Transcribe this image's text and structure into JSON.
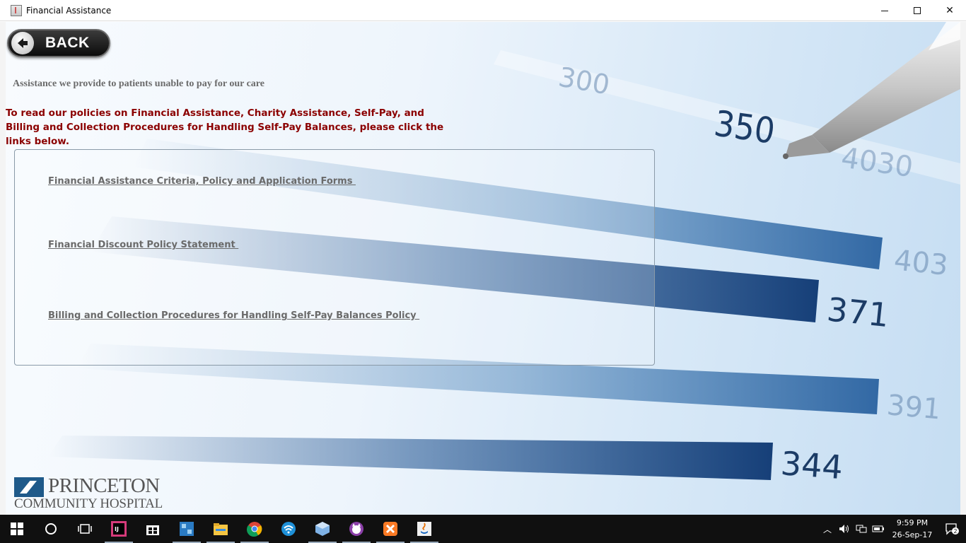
{
  "window": {
    "title": "Financial Assistance"
  },
  "back_button": {
    "label": "BACK"
  },
  "subtitle": "Assistance we provide to patients unable to pay for our care",
  "intro": "To read our policies on Financial Assistance, Charity Assistance, Self-Pay, and Billing and Collection Procedures for Handling Self-Pay Balances, please click the links below.",
  "links": [
    {
      "label": "Financial Assistance Criteria, Policy and Application Forms "
    },
    {
      "label": "Financial Discount Policy Statement "
    },
    {
      "label": "Billing and Collection Procedures for Handling Self-Pay Balances Policy "
    }
  ],
  "logo": {
    "line1": "PRINCETON",
    "line2": "COMMUNITY HOSPITAL"
  },
  "background_numbers": [
    "350",
    "371",
    "344",
    "4030",
    "403",
    "391",
    "300"
  ],
  "taskbar": {
    "apps": [
      "start-icon",
      "cortana-icon",
      "task-view-icon",
      "intellij-icon",
      "store-icon",
      "netbeans-icon",
      "file-explorer-icon",
      "chrome-icon",
      "wifi-app-icon",
      "virtualbox-icon",
      "cat-app-icon",
      "xampp-icon",
      "java-icon"
    ],
    "time": "9:59 PM",
    "date": "26-Sep-17",
    "notification_count": "2"
  },
  "colors": {
    "intro": "#8b0000",
    "link": "#6a6a6a",
    "logo_blue": "#1f5a8a",
    "taskbar": "#101010"
  }
}
